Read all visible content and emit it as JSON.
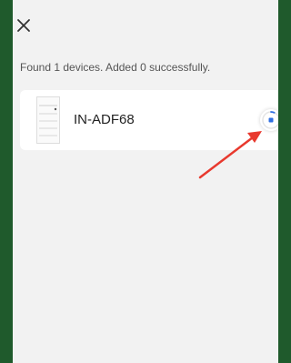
{
  "app": {
    "close_icon": "close-icon"
  },
  "status": {
    "text": "Found 1 devices. Added 0 successfully."
  },
  "device": {
    "name": "IN-ADF68",
    "icon": "thermostat-device-icon",
    "state": "adding",
    "progress_icon": "stop-progress-icon"
  },
  "colors": {
    "frame": "#1f5a2c",
    "background": "#f2f2f2",
    "card": "#ffffff",
    "accent": "#2f6fe2",
    "annotation_arrow": "#e8392e"
  }
}
